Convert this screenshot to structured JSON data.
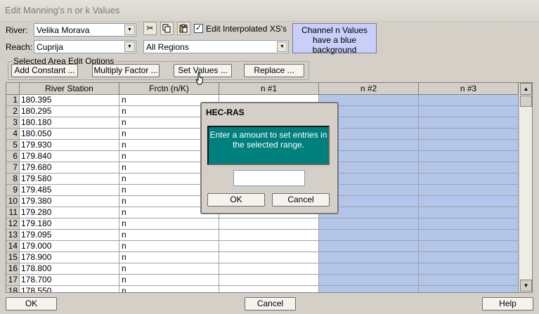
{
  "window": {
    "title": "Edit Manning's n or k Values"
  },
  "river": {
    "label": "River:",
    "value": "Velika Morava"
  },
  "reach": {
    "label": "Reach:",
    "value": "Cuprija"
  },
  "regions": {
    "value": "All Regions"
  },
  "toolbar": {
    "cut_icon": "scissors-icon",
    "copy_icon": "copy-icon",
    "paste_icon": "paste-icon"
  },
  "edit_interpolated": {
    "label": "Edit Interpolated XS's",
    "checked": true
  },
  "note": "Channel n Values have a blue background",
  "edit_options": {
    "title": "Selected Area Edit Options",
    "add_constant": "Add Constant ...",
    "multiply_factor": "Multiply Factor ...",
    "set_values": "Set Values ...",
    "replace": "Replace ..."
  },
  "table": {
    "headers": [
      "River Station",
      "Frctn (n/K)",
      "n #1",
      "n #2",
      "n #3"
    ],
    "rows": [
      {
        "num": "1",
        "station": "180.395",
        "frctn": "n"
      },
      {
        "num": "2",
        "station": "180.295",
        "frctn": "n"
      },
      {
        "num": "3",
        "station": "180.180",
        "frctn": "n"
      },
      {
        "num": "4",
        "station": "180.050",
        "frctn": "n"
      },
      {
        "num": "5",
        "station": "179.930",
        "frctn": "n"
      },
      {
        "num": "6",
        "station": "179.840",
        "frctn": "n"
      },
      {
        "num": "7",
        "station": "179.680",
        "frctn": "n"
      },
      {
        "num": "8",
        "station": "179.580",
        "frctn": "n"
      },
      {
        "num": "9",
        "station": "179.485",
        "frctn": "n"
      },
      {
        "num": "10",
        "station": "179.380",
        "frctn": "n"
      },
      {
        "num": "11",
        "station": "179.280",
        "frctn": "n"
      },
      {
        "num": "12",
        "station": "179.180",
        "frctn": "n"
      },
      {
        "num": "13",
        "station": "179.095",
        "frctn": "n"
      },
      {
        "num": "14",
        "station": "179.000",
        "frctn": "n"
      },
      {
        "num": "15",
        "station": "178.900",
        "frctn": "n"
      },
      {
        "num": "16",
        "station": "178.800",
        "frctn": "n"
      },
      {
        "num": "17",
        "station": "178.700",
        "frctn": "n"
      },
      {
        "num": "18",
        "station": "178.550",
        "frctn": "n"
      }
    ]
  },
  "dialog": {
    "title": "HEC-RAS",
    "message": "Enter a amount to set entries in the selected range.",
    "input_value": "",
    "ok": "OK",
    "cancel": "Cancel"
  },
  "footer": {
    "ok": "OK",
    "cancel": "Cancel",
    "help": "Help"
  },
  "colors": {
    "channel_bg": "#b3c6ea",
    "dialog_msg_bg": "#00807d",
    "note_bg": "#c8cff8"
  }
}
